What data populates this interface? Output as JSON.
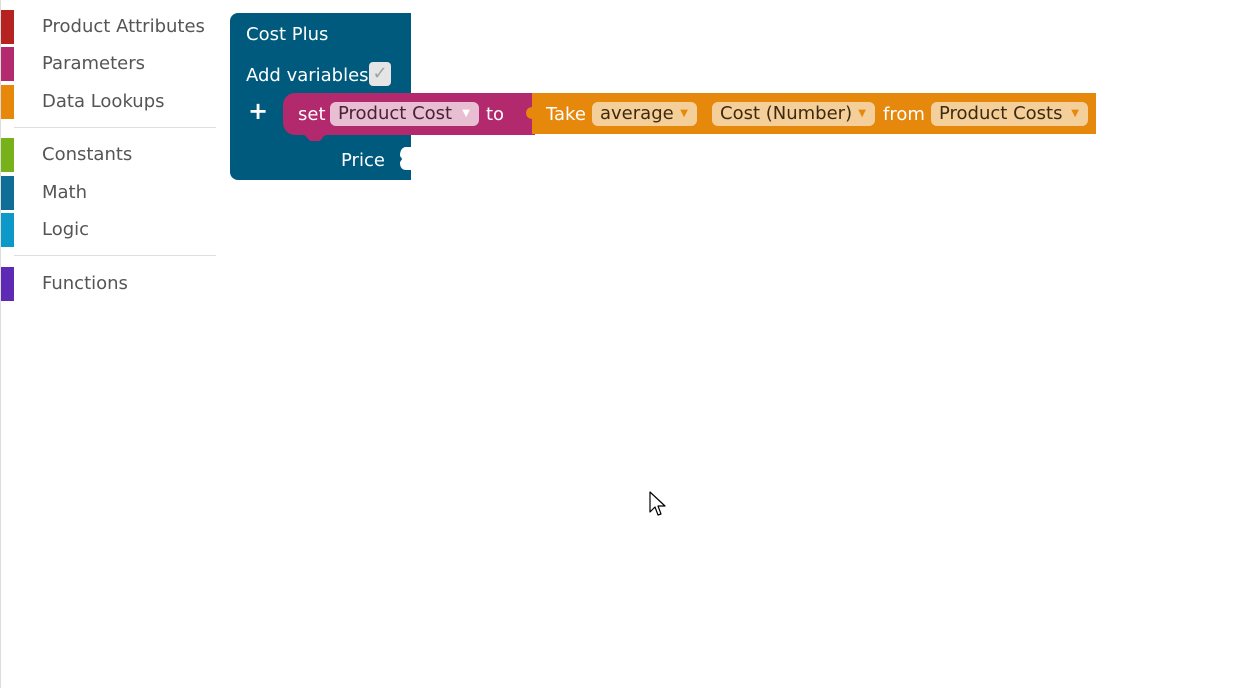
{
  "toolbox": {
    "categories": [
      {
        "label": "Product Attributes",
        "color": "#b5221f"
      },
      {
        "label": "Parameters",
        "color": "#b32a6e"
      },
      {
        "label": "Data Lookups",
        "color": "#e8880a"
      },
      {
        "label": "Constants",
        "color": "#77b21b"
      },
      {
        "label": "Math",
        "color": "#0f6e95"
      },
      {
        "label": "Logic",
        "color": "#0d98ca"
      },
      {
        "label": "Functions",
        "color": "#5e2ab5"
      }
    ]
  },
  "workspace": {
    "function_block": {
      "title": "Cost Plus",
      "add_variables_label": "Add variables",
      "add_variables_checked": true,
      "checkbox_mark": "✓",
      "plus_label": "+",
      "return_label": "Price",
      "color": "#005a7d"
    },
    "set_block": {
      "set_label": "set",
      "variable": "Product Cost",
      "to_label": "to",
      "color": "#b2296d"
    },
    "take_block": {
      "take_label": "Take",
      "aggregate": "average",
      "field": "Cost (Number)",
      "from_label": "from",
      "source": "Product Costs",
      "color": "#e5880c"
    },
    "dropdown_arrow": "▼"
  }
}
